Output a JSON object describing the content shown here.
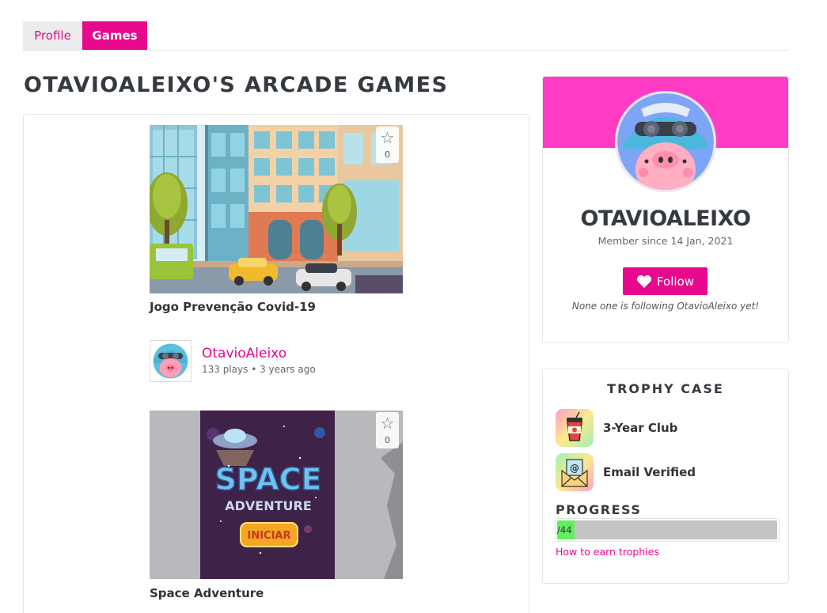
{
  "tabs": [
    {
      "label": "Profile",
      "active": false
    },
    {
      "label": "Games",
      "active": true
    }
  ],
  "page_title": "OTAVIOALEIXO'S ARCADE GAMES",
  "games": [
    {
      "title": "Jogo Prevenção Covid-19",
      "favorites": "0",
      "thumbnail": "city-street-illustration",
      "author": {
        "name": "OtavioAleixo",
        "meta": "133 plays • 3 years ago"
      }
    },
    {
      "title": "Space Adventure",
      "favorites": "0",
      "thumbnail": "space-adventure-title-screen",
      "thumb_text": {
        "line1": "SPACE",
        "line2": "ADVENTURE",
        "button": "INICIAR"
      }
    }
  ],
  "profile": {
    "username": "OTAVIOALEIXO",
    "member_since": "Member since 14 Jan, 2021",
    "follow_label": "Follow",
    "follow_note": "None one is following OtavioAleixo yet!"
  },
  "trophies": {
    "title": "TROPHY CASE",
    "items": [
      {
        "label": "3-Year Club",
        "icon": "coffee-cup-icon"
      },
      {
        "label": "Email Verified",
        "icon": "envelope-icon"
      }
    ],
    "progress_title": "PROGRESS",
    "progress_text": "/44",
    "progress_fraction": 0.08,
    "earn_link": "How to earn trophies"
  },
  "colors": {
    "accent": "#e8088e",
    "banner": "#ff3cc4",
    "progress_fill": "#5ff05f"
  }
}
